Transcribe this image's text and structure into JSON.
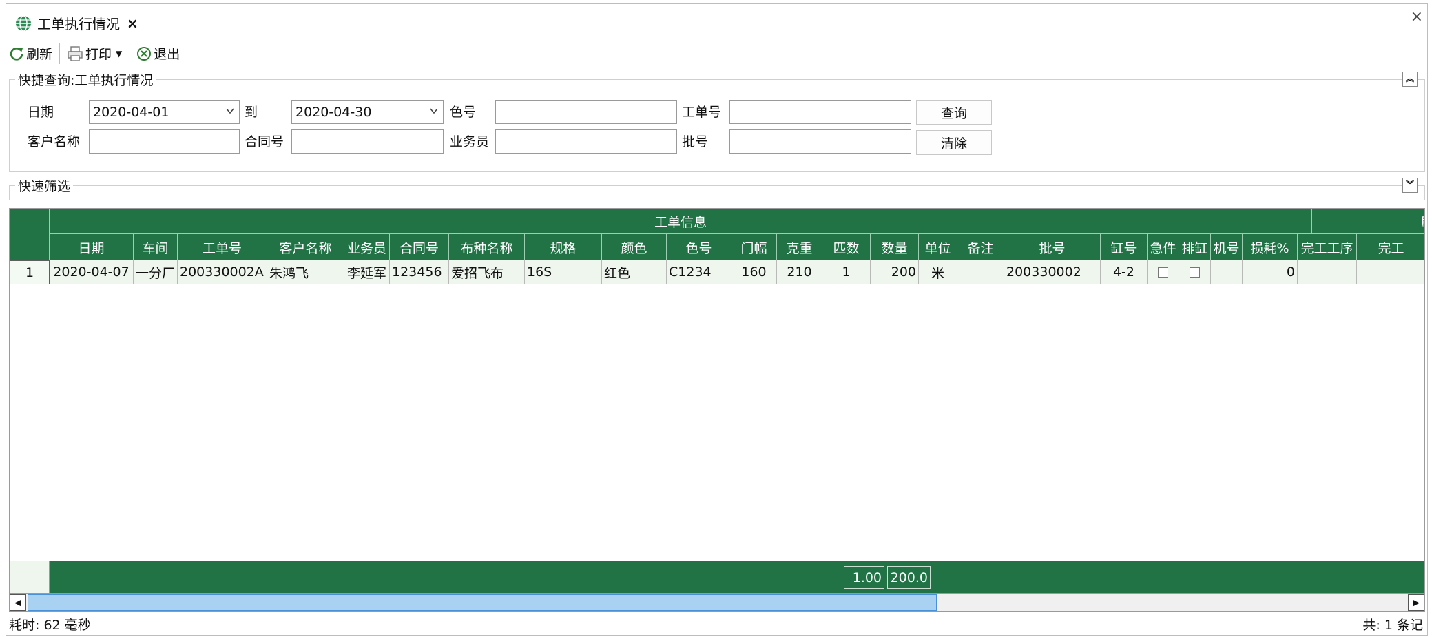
{
  "tab": {
    "title": "工单执行情况",
    "close": "×"
  },
  "window": {
    "close": "×"
  },
  "toolbar": {
    "refresh": "刷新",
    "print": "打印",
    "exit": "退出"
  },
  "query": {
    "title": "快捷查询:工单执行情况",
    "date_label": "日期",
    "date_from": "2020-04-01",
    "to_label": "到",
    "date_to": "2020-04-30",
    "color_no_label": "色号",
    "color_no": "",
    "order_no_label": "工单号",
    "order_no": "",
    "customer_label": "客户名称",
    "customer": "",
    "contract_label": "合同号",
    "contract": "",
    "salesman_label": "业务员",
    "salesman": "",
    "batch_label": "批号",
    "batch": "",
    "search_btn": "查询",
    "clear_btn": "清除"
  },
  "filter": {
    "title": "快速筛选"
  },
  "grid": {
    "band1": "工单信息",
    "band2": "刷卡",
    "columns": [
      "日期",
      "车间",
      "工单号",
      "客户名称",
      "业务员",
      "合同号",
      "布种名称",
      "规格",
      "颜色",
      "色号",
      "门幅",
      "克重",
      "匹数",
      "数量",
      "单位",
      "备注",
      "批号",
      "缸号",
      "急件",
      "排缸",
      "机号",
      "损耗%",
      "完工工序",
      "完工"
    ],
    "rows": [
      {
        "num": "1",
        "date": "2020-04-07",
        "workshop": "一分厂",
        "order_no": "200330002A",
        "customer": "朱鸿飞",
        "salesman": "李延军",
        "contract": "123456",
        "fabric": "爱招飞布",
        "spec": "16S",
        "color": "红色",
        "color_no": "C1234",
        "width": "160",
        "weight": "210",
        "pieces": "1",
        "qty": "200",
        "unit": "米",
        "remark": "",
        "batch": "200330002",
        "vat": "4-2",
        "urgent": false,
        "scheduled": false,
        "machine": "",
        "loss": "0",
        "done_proc": "",
        "done": ""
      }
    ],
    "sum_pieces": "1.00",
    "sum_qty": "200.0"
  },
  "status": {
    "elapsed": "耗时: 62 毫秒",
    "count": "共: 1 条记"
  }
}
